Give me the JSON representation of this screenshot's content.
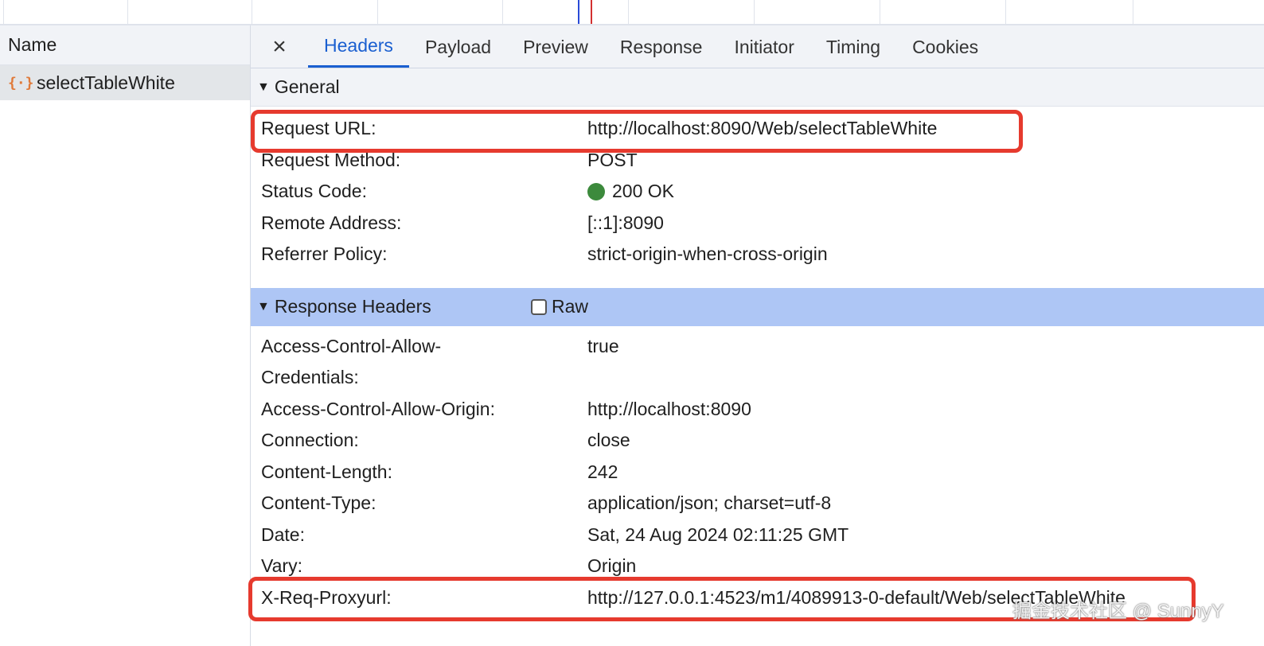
{
  "left_panel": {
    "header": "Name",
    "request": {
      "icon": "json-braces-icon",
      "name": "selectTableWhite"
    }
  },
  "tabs": {
    "close_icon": "×",
    "items": [
      "Headers",
      "Payload",
      "Preview",
      "Response",
      "Initiator",
      "Timing",
      "Cookies"
    ],
    "active": "Headers"
  },
  "general": {
    "title": "General",
    "rows": [
      {
        "key": "Request URL:",
        "value": "http://localhost:8090/Web/selectTableWhite"
      },
      {
        "key": "Request Method:",
        "value": "POST"
      },
      {
        "key": "Status Code:",
        "value": "200 OK"
      },
      {
        "key": "Remote Address:",
        "value": "[::1]:8090"
      },
      {
        "key": "Referrer Policy:",
        "value": "strict-origin-when-cross-origin"
      }
    ]
  },
  "response_headers": {
    "title": "Response Headers",
    "raw_label": "Raw",
    "raw_checked": false,
    "rows": [
      {
        "key": "Access-Control-Allow-",
        "key2": "Credentials:",
        "value": "true"
      },
      {
        "key": "Access-Control-Allow-Origin:",
        "value": "http://localhost:8090"
      },
      {
        "key": "Connection:",
        "value": "close"
      },
      {
        "key": "Content-Length:",
        "value": "242"
      },
      {
        "key": "Content-Type:",
        "value": "application/json; charset=utf-8"
      },
      {
        "key": "Date:",
        "value": "Sat, 24 Aug 2024 02:11:25 GMT"
      },
      {
        "key": "Vary:",
        "value": "Origin"
      },
      {
        "key": "X-Req-Proxyurl:",
        "value": "http://127.0.0.1:4523/m1/4089913-0-default/Web/selectTableWhite"
      }
    ]
  },
  "colors": {
    "active_tab": "#1a5fd0",
    "status_ok": "#3c8a3c",
    "highlight": "#e63a2e",
    "section_selected": "#aec6f5",
    "request_icon": "#e07a3a"
  },
  "watermark": "掘金技术社区 @ SunnyY"
}
